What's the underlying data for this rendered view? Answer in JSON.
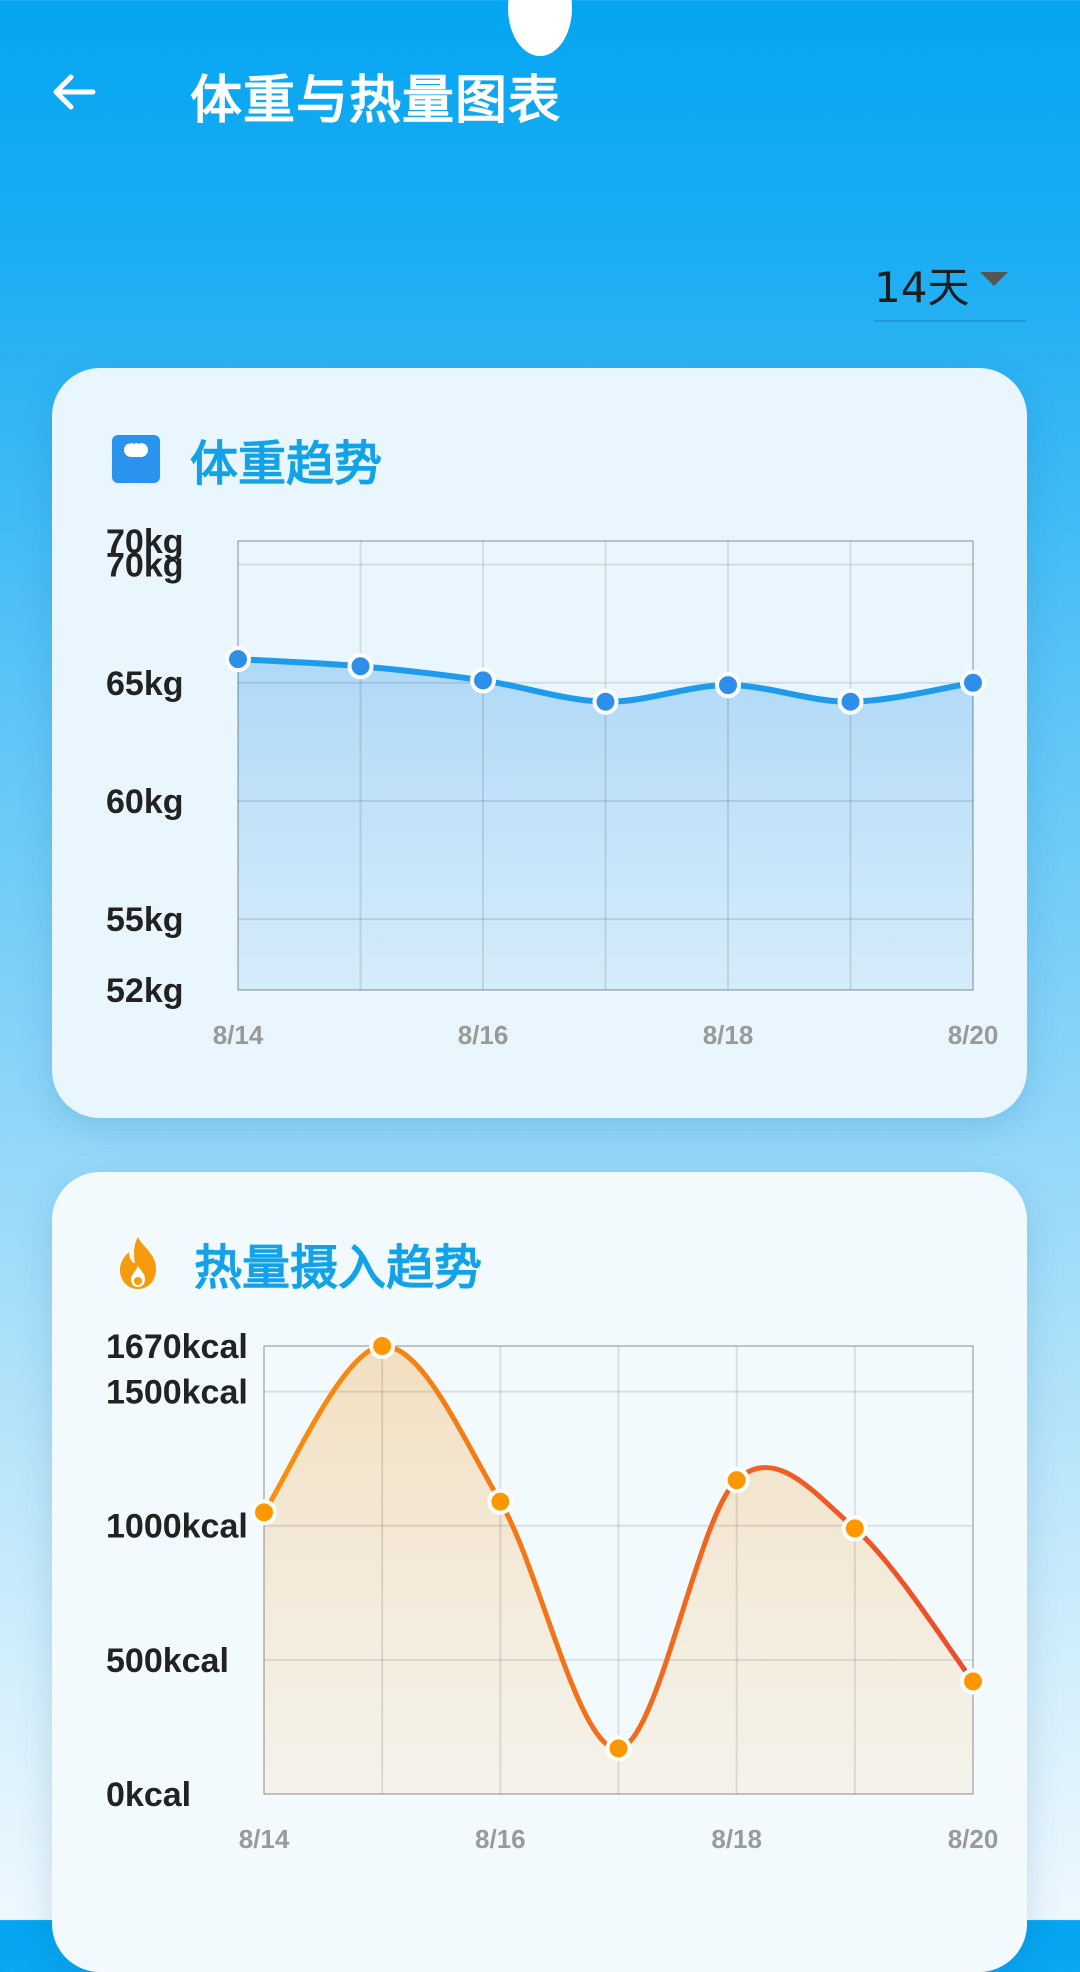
{
  "app_bar": {
    "title": "体重与热量图表"
  },
  "range_select": {
    "value": "14天"
  },
  "colors": {
    "primary": "#05A5F1",
    "weight_line": "#1E9BEB",
    "weight_point": "#2E8FEB",
    "calorie_start": "#F7900B",
    "calorie_end": "#EE4B2B",
    "calorie_point": "#FF9800"
  },
  "weight_card": {
    "title": "体重趋势",
    "icon": "scale-icon"
  },
  "calorie_card": {
    "title": "热量摄入趋势",
    "icon": "fire-icon"
  },
  "chart_data": [
    {
      "type": "line",
      "title": "体重趋势",
      "unit": "kg",
      "x": [
        "8/14",
        "8/15",
        "8/16",
        "8/17",
        "8/18",
        "8/19",
        "8/20"
      ],
      "xtick_labels": [
        "8/14",
        "8/16",
        "8/18",
        "8/20"
      ],
      "ytick_labels": [
        "70kg",
        "70kg",
        "65kg",
        "60kg",
        "55kg",
        "52kg"
      ],
      "ytick_values": [
        71,
        70,
        65,
        60,
        55,
        52
      ],
      "ylim": [
        52,
        71
      ],
      "series": [
        {
          "values": [
            66.0,
            65.7,
            65.1,
            64.2,
            64.9,
            64.2,
            65.0
          ]
        }
      ],
      "fill_area": true,
      "grid": true
    },
    {
      "type": "area",
      "title": "热量摄入趋势",
      "unit": "kcal",
      "x": [
        "8/14",
        "8/15",
        "8/16",
        "8/17",
        "8/18",
        "8/19",
        "8/20"
      ],
      "xtick_labels": [
        "8/14",
        "8/16",
        "8/18",
        "8/20"
      ],
      "ytick_labels": [
        "1670kcal",
        "1500kcal",
        "1000kcal",
        "500kcal",
        "0kcal"
      ],
      "ytick_values": [
        1670,
        1500,
        1000,
        500,
        0
      ],
      "ylim": [
        0,
        1670
      ],
      "series": [
        {
          "values": [
            1050,
            1670,
            1090,
            170,
            1170,
            990,
            420
          ]
        }
      ],
      "grid": true
    }
  ]
}
